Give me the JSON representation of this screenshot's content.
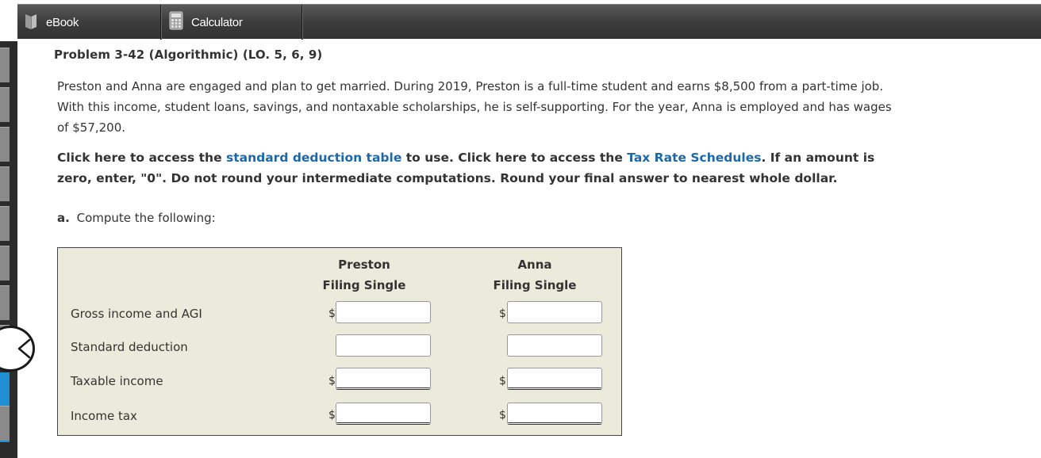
{
  "toolbar": {
    "tabs": [
      {
        "label": "eBook",
        "icon": "book-icon"
      },
      {
        "label": "Calculator",
        "icon": "calculator-icon"
      }
    ],
    "colors": {
      "bar": "#3c3c3c",
      "text": "#ffffff"
    }
  },
  "problem": {
    "title": "Problem 3-42 (Algorithmic) (LO. 5, 6, 9)",
    "paragraph": "Preston and Anna are engaged and plan to get married. During 2019, Preston is a full-time student and earns $8,500 from a part-time job. With this income, student loans, savings, and nontaxable scholarships, he is self-supporting. For the year, Anna is employed and has wages of $57,200.",
    "instructions": {
      "part1": "Click here to access the ",
      "link1": "standard deduction table",
      "part2": " to use. Click here to access the ",
      "link2": "Tax Rate Schedules",
      "part3": ". If an amount is zero, enter, \"0\". Do not round your intermediate computations. Round your final answer to nearest whole dollar."
    },
    "part_a": {
      "letter": "a.",
      "text": "Compute the following:"
    }
  },
  "table": {
    "columns": [
      {
        "line1": "Preston",
        "line2": "Filing Single"
      },
      {
        "line1": "Anna",
        "line2": "Filing Single"
      }
    ],
    "rows": [
      {
        "label": "Gross income and AGI",
        "prefix": "$",
        "preston_value": "",
        "anna_value": ""
      },
      {
        "label": "Standard deduction",
        "prefix": "",
        "preston_value": "",
        "anna_value": ""
      },
      {
        "label": "Taxable income",
        "prefix": "$",
        "preston_value": "",
        "anna_value": ""
      },
      {
        "label": "Income tax",
        "prefix": "$",
        "preston_value": "",
        "anna_value": ""
      }
    ],
    "colors": {
      "background": "#ebebdc",
      "link": "#1c68a8"
    }
  },
  "nav": {
    "back_icon": "chevron-left-icon"
  }
}
